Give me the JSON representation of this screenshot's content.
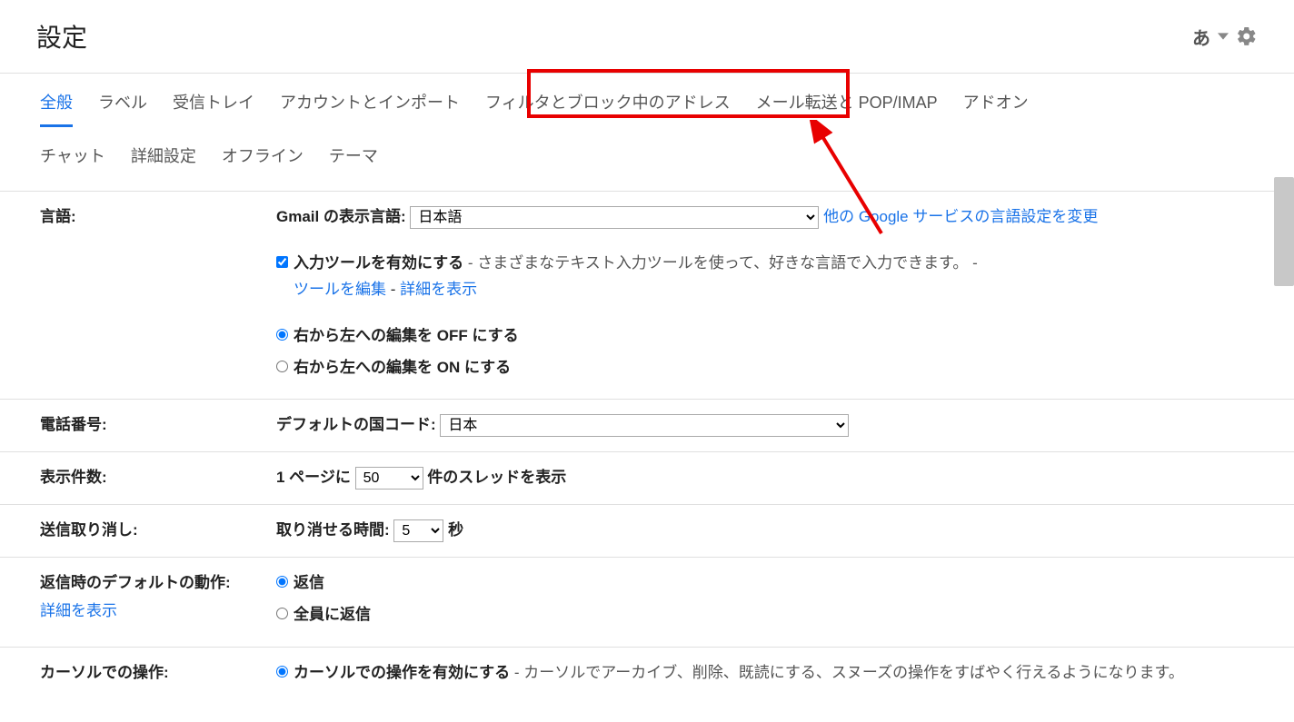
{
  "header": {
    "title": "設定",
    "ime": "あ"
  },
  "tabs": {
    "row1": [
      "全般",
      "ラベル",
      "受信トレイ",
      "アカウントとインポート",
      "フィルタとブロック中のアドレス",
      "メール転送と POP/IMAP",
      "アドオン"
    ],
    "row2": [
      "チャット",
      "詳細設定",
      "オフライン",
      "テーマ"
    ],
    "active_index": 0,
    "highlight_index": 4
  },
  "language": {
    "label": "言語:",
    "display_label": "Gmail の表示言語:",
    "selected": "日本語",
    "other_link": "他の Google サービスの言語設定を変更",
    "ime_enable_bold": "入力ツールを有効にする",
    "ime_enable_desc": " - さまざまなテキスト入力ツールを使って、好きな言語で入力できます。  -",
    "edit_tools": "ツールを編集",
    "dash": " - ",
    "show_details": "詳細を表示",
    "rtl_off": "右から左への編集を OFF にする",
    "rtl_on": "右から左への編集を ON にする"
  },
  "phone": {
    "label": "電話番号:",
    "default_cc_label": "デフォルトの国コード:",
    "selected": "日本"
  },
  "pagesize": {
    "label": "表示件数:",
    "prefix": "1 ページに",
    "value": "50",
    "suffix": "件のスレッドを表示"
  },
  "undo": {
    "label": "送信取り消し:",
    "prefix": "取り消せる時間:",
    "value": "5",
    "suffix": "秒"
  },
  "reply": {
    "label": "返信時のデフォルトの動作:",
    "sublink": "詳細を表示",
    "opt1": "返信",
    "opt2": "全員に返信"
  },
  "hover": {
    "label": "カーソルでの操作:",
    "opt_bold": "カーソルでの操作を有効にする",
    "opt_desc": " - カーソルでアーカイブ、削除、既読にする、スヌーズの操作をすばやく行えるようになります。"
  }
}
